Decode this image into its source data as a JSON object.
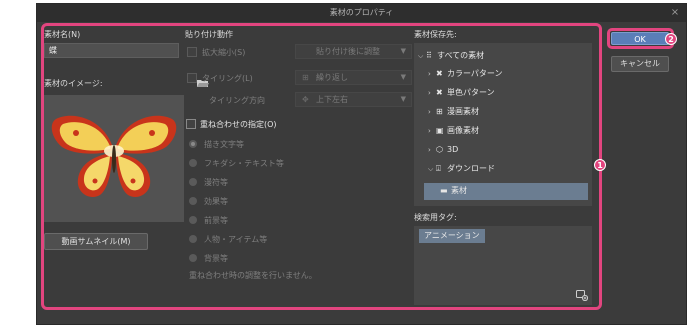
{
  "dialog": {
    "title": "素材のプロパティ",
    "close_icon": "×"
  },
  "left": {
    "name_label": "素材名(N)",
    "name_value": "蝶",
    "image_label": "素材のイメージ:",
    "thumb_button": "動画サムネイル(M)"
  },
  "paste": {
    "heading": "貼り付け動作",
    "scale_label": "拡大縮小(S)",
    "scale_dropdown": "貼り付け後に調整",
    "tiling_label": "タイリング(L)",
    "tiling_dropdown": "繰り返し",
    "tiling_dir_label": "タイリング方向",
    "tiling_dir_dropdown": "上下左右",
    "overlap_label": "重ね合わせの指定(O)",
    "radios": [
      "描き文字等",
      "フキダシ・テキスト等",
      "漫符等",
      "効果等",
      "前景等",
      "人物・アイテム等",
      "背景等"
    ],
    "note": "重ね合わせ時の調整を行いません。"
  },
  "save": {
    "label": "素材保存先:",
    "tree": [
      "すべての素材",
      "カラーパターン",
      "単色パターン",
      "漫画素材",
      "画像素材",
      "3D",
      "ダウンロード",
      "素材"
    ]
  },
  "search": {
    "label": "検索用タグ:",
    "tag": "アニメーション"
  },
  "actions": {
    "ok": "OK",
    "cancel": "キャンセル"
  },
  "annotations": {
    "badge1": "1",
    "badge2": "2"
  },
  "colors": {
    "highlight": "#e2457f",
    "selection": "#6b7d91",
    "ok_button": "#5a7eb8"
  }
}
